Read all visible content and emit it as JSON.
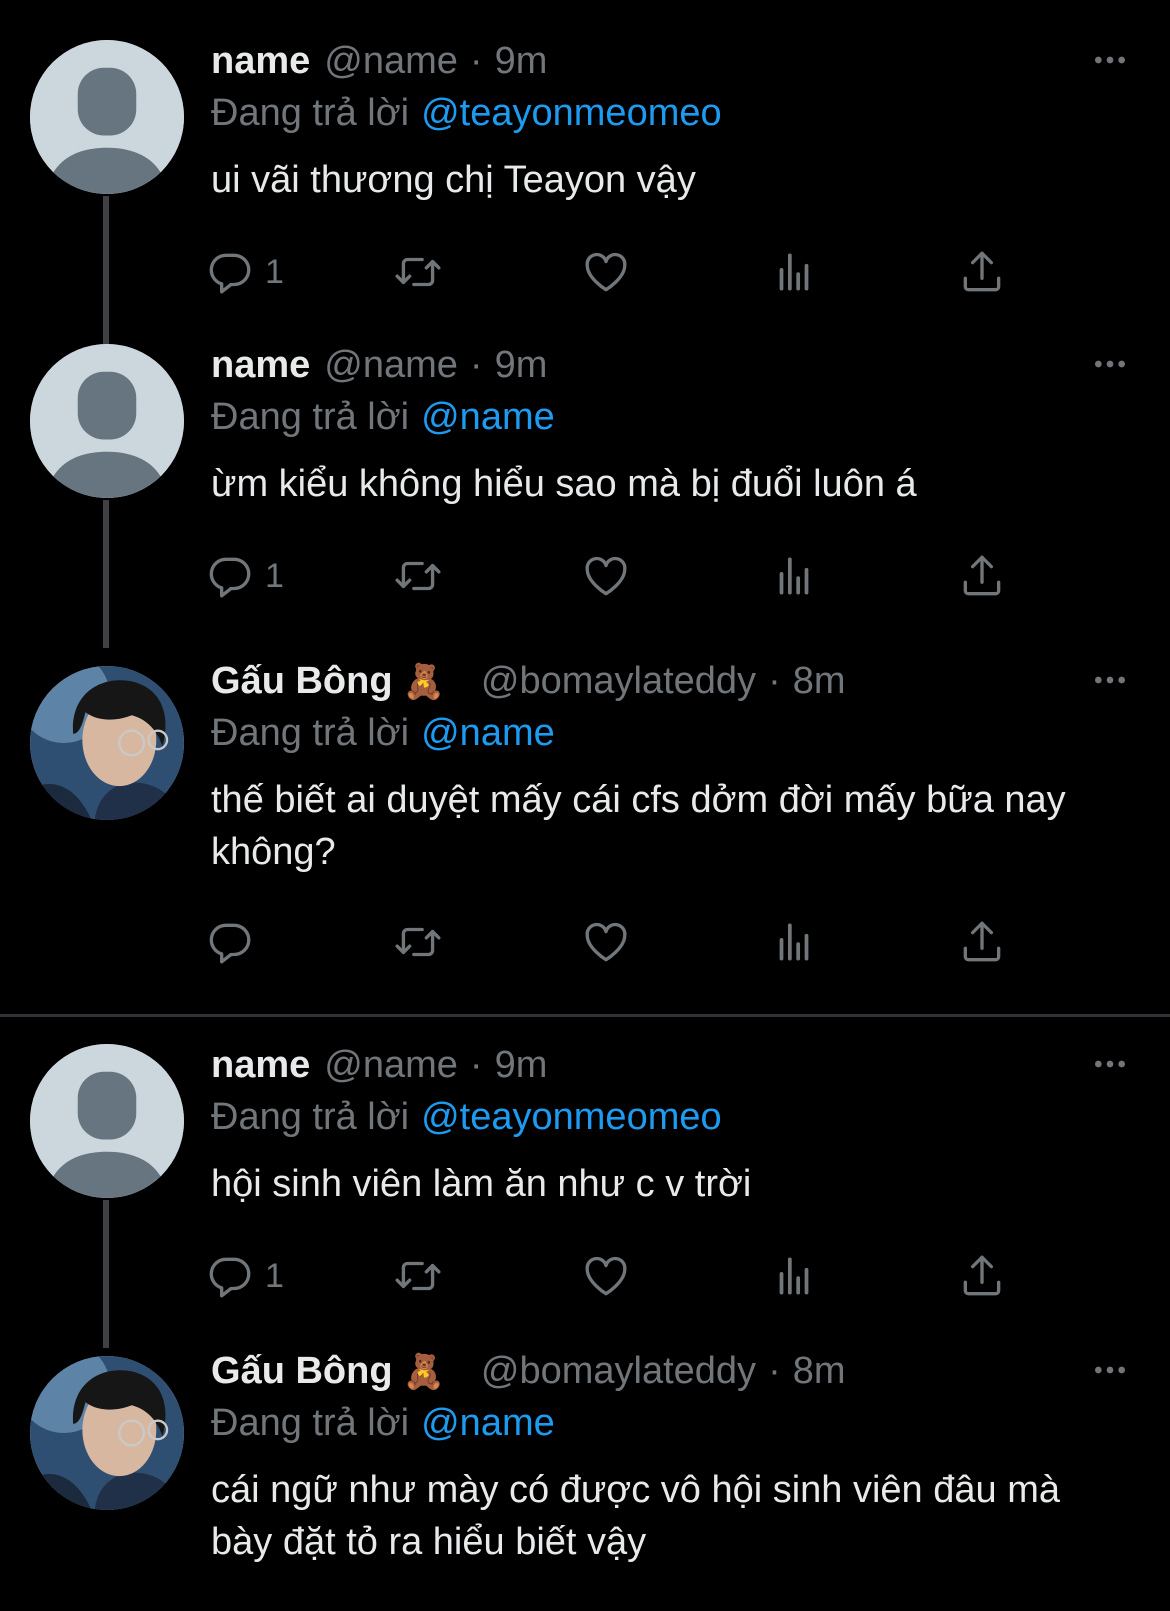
{
  "tweets": [
    {
      "author_name": "name",
      "emoji": "",
      "handle": "@name",
      "separator": "·",
      "time": "9m",
      "reply_label": "Đang trả lời",
      "reply_to": "@teayonmeomeo",
      "text": "ui vãi thương chị Teayon vậy",
      "reply_count": "1",
      "avatar": "default-avatar"
    },
    {
      "author_name": "name",
      "emoji": "",
      "handle": "@name",
      "separator": "·",
      "time": "9m",
      "reply_label": "Đang trả lời",
      "reply_to": "@name",
      "text": "ừm kiểu không hiểu sao mà bị đuổi luôn á",
      "reply_count": "1",
      "avatar": "default-avatar"
    },
    {
      "author_name": "Gấu Bông",
      "emoji": "🧸",
      "handle": "@bomaylateddy",
      "separator": "·",
      "time": "8m",
      "reply_label": "Đang trả lời",
      "reply_to": "@name",
      "text": "thế biết ai duyệt mấy cái cfs dởm đời mấy bữa nay không?",
      "reply_count": "",
      "avatar": "photo-avatar"
    },
    {
      "author_name": "name",
      "emoji": "",
      "handle": "@name",
      "separator": "·",
      "time": "9m",
      "reply_label": "Đang trả lời",
      "reply_to": "@teayonmeomeo",
      "text": "hội sinh viên làm ăn như c v trời",
      "reply_count": "1",
      "avatar": "default-avatar"
    },
    {
      "author_name": "Gấu Bông",
      "emoji": "🧸",
      "handle": "@bomaylateddy",
      "separator": "·",
      "time": "8m",
      "reply_label": "Đang trả lời",
      "reply_to": "@name",
      "text": "cái ngữ như mày có được vô hội sinh viên đâu mà bày đặt tỏ ra hiểu biết vậy",
      "reply_count": "",
      "avatar": "photo-avatar"
    }
  ],
  "icons": {
    "reply": "reply-icon",
    "retweet": "retweet-icon",
    "like": "heart-icon",
    "views": "views-icon",
    "share": "share-icon",
    "more": "more-icon"
  },
  "colors": {
    "background": "#000000",
    "text": "#e7e9ea",
    "muted": "#71767b",
    "mention": "#1d9bf0",
    "thread_line": "#3e4144"
  }
}
